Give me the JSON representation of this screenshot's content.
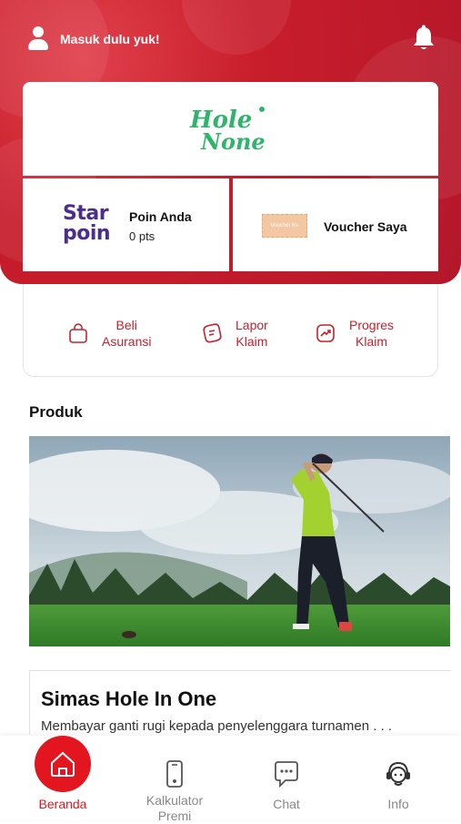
{
  "header": {
    "login_prompt": "Masuk dulu yuk!"
  },
  "brand": {
    "logo_text": "HoleNone"
  },
  "points": {
    "logo_line1": "Star",
    "logo_line2": "poin",
    "title": "Poin Anda",
    "value": "0 pts"
  },
  "voucher": {
    "ticket_text": "Voucher Ku",
    "label": "Voucher Saya"
  },
  "actions": [
    {
      "line1": "Beli",
      "line2": "Asuransi",
      "icon": "shopping-bag-icon"
    },
    {
      "line1": "Lapor",
      "line2": "Klaim",
      "icon": "report-claim-icon"
    },
    {
      "line1": "Progres",
      "line2": "Klaim",
      "icon": "progress-chart-icon"
    }
  ],
  "products": {
    "section_title": "Produk",
    "items": [
      {
        "title": "Simas Hole In One",
        "description": "Membayar ganti rugi kepada penyelenggara turnamen . . ."
      }
    ]
  },
  "bottom_nav": [
    {
      "label": "Beranda",
      "icon": "home-icon",
      "active": true
    },
    {
      "label": "Kalkulator Premi",
      "line1": "Kalkulator",
      "line2": "Premi",
      "icon": "phone-calculator-icon",
      "active": false
    },
    {
      "label": "Chat",
      "icon": "chat-icon",
      "active": false
    },
    {
      "label": "Info",
      "icon": "support-agent-icon",
      "active": false
    }
  ],
  "colors": {
    "brand_red": "#c81d2b",
    "active_red": "#e3161f",
    "starpoin_purple": "#4b2d8f",
    "holeinone_green": "#2fb56b"
  }
}
